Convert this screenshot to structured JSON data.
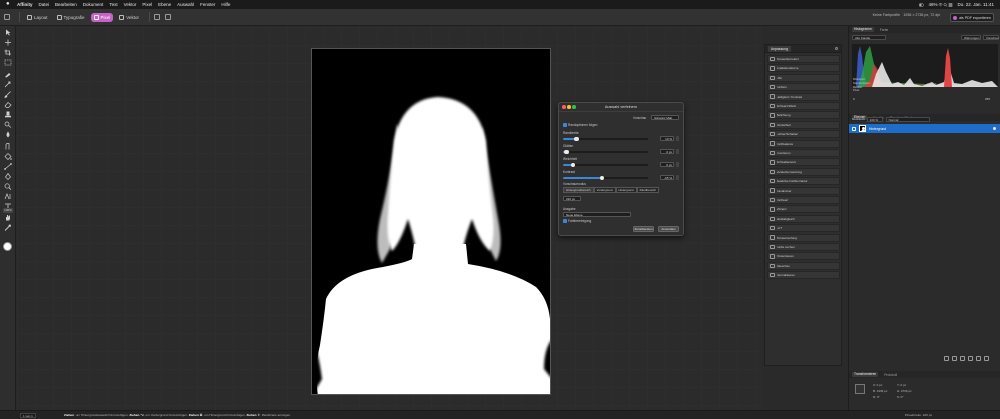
{
  "menubar": {
    "app": "Affinity",
    "items": [
      "Datei",
      "Bearbeiten",
      "Dokument",
      "Text",
      "Vektor",
      "Pixel",
      "Ebene",
      "Auswahl",
      "Fenster",
      "Hilfe"
    ],
    "status": {
      "battery": "46%",
      "datetime": "Do. 22. Jan. 11:41"
    }
  },
  "toolbar": {
    "buttons": [
      {
        "label": "Layout",
        "active": false
      },
      {
        "label": "Typografie",
        "active": false
      },
      {
        "label": "Pixel",
        "active": true
      },
      {
        "label": "Vektor",
        "active": false
      }
    ],
    "doc_info": "Keine Farbprofile",
    "doc_info2": "1936 × 2736 px, 72 dpi",
    "export_label": "als PDF exportieren",
    "accent": "#c662c8"
  },
  "tools": {
    "zoom_badge": "100%",
    "icons": [
      "pointer-icon",
      "move-icon",
      "crop-icon",
      "selection-brush-icon",
      "marquee-icon",
      "flood-select-icon",
      "paint-brush-icon",
      "erase-icon",
      "clone-icon",
      "dodge-icon",
      "blur-icon",
      "smudge-icon",
      "fill-icon",
      "gradient-icon",
      "pen-icon",
      "text-icon",
      "shape-icon",
      "hand-icon",
      "zoom-icon",
      "color-picker-icon"
    ]
  },
  "dialog": {
    "title": "Auswahl verfeinern",
    "mode_label": "Vorschau",
    "mode_value": "Schwarz Matt",
    "checkbox_label": "Randoptionen folgen",
    "sliders": [
      {
        "label": "Randbreite",
        "value": "10 %",
        "fraction": 0.16
      },
      {
        "label": "Glätten",
        "value": "0 px",
        "fraction": 0.04
      },
      {
        "label": "Weichheit",
        "value": "0 px",
        "fraction": 0.12
      },
      {
        "label": "Kontrast",
        "value": "-65 %",
        "fraction": 0.46
      }
    ],
    "output_label": "Vorschaumodus",
    "segments": [
      {
        "label": "Hintergrundbereich",
        "on": true
      },
      {
        "label": "Vordergrund",
        "on": false
      },
      {
        "label": "Hintergrund",
        "on": false
      },
      {
        "label": "Randbereich",
        "on": false
      }
    ],
    "brush_size": "220 px",
    "output_title": "Ausgabe",
    "output_value": "Neue Ebene",
    "checkbox2_label": "Farbbereinigung",
    "btn_reset": "Zurücksetzen",
    "btn_apply": "Anwenden"
  },
  "adjustments": {
    "tab": "Anpassung",
    "items": [
      "Tonwertkorrektur",
      "Gradationskurve",
      "HSL",
      "Farbton",
      "Helligkeit / Kontrast",
      "Schwarz/Weiß",
      "Belichtung",
      "Dunkelheit",
      "Lichter/Schatten",
      "Farbbalance",
      "Invertieren",
      "Schwellenwert",
      "Verlaufsumsetzung",
      "Selektive Farbkorrektur",
      "Kanalmixer",
      "Farbwert",
      "Vibranz",
      "Weißabgleich",
      "LUT",
      "Tonwertumfang",
      "Farbe suchen",
      "Posterisieren",
      "Rauschen",
      "Normalisieren"
    ]
  },
  "studio": {
    "top_tabs": [
      "Histogramm",
      "Farbe"
    ],
    "hist_controls": {
      "channel": "Alle Kanäle",
      "btn1": "Warnungen",
      "btn2": "Vorschau"
    },
    "stats": [
      "Mittelwert:",
      "Standardabw.:",
      "Median:",
      "Pixel:"
    ],
    "stats_vals": "0 / 0 / 0",
    "levels": [
      "0",
      "255"
    ],
    "layer_tabs": [
      "Ebenen",
      "Kanäle",
      "Pinsel",
      "Stock"
    ],
    "opacity_label": "Deckkraft",
    "opacity_value": "100 %",
    "blend_value": "Normal",
    "layer_name": "Hintergrund",
    "transform_tabs": [
      "Transformieren",
      "Protokoll"
    ],
    "transform_fields": [
      "X: 0 px",
      "Y: 0 px",
      "B: 1936 px",
      "H: 2736 px",
      "R: 0°",
      "S: 0°"
    ],
    "selection_color": "#1e6ec9"
  },
  "statusbar": {
    "page": "1 von 1",
    "hint_a": "Ziehen",
    "hint_a_text": ", um Hintergrundauswahl hinzuzufügen.",
    "hint_b": "Ziehen",
    "hint_b_mod": "⌥",
    "hint_b_text": ", um Vordergrund hinzuzufügen.",
    "hint_c": "Ziehen",
    "hint_c_mod": "⌘",
    "hint_c_text": ", um Hintergrund hinzuzufügen.",
    "hint_d": "Ziehen",
    "hint_d_mod": "⇧",
    "hint_d_text": ", Randbreite anzeigen.",
    "right": "Pinselbreite: 220 px"
  }
}
